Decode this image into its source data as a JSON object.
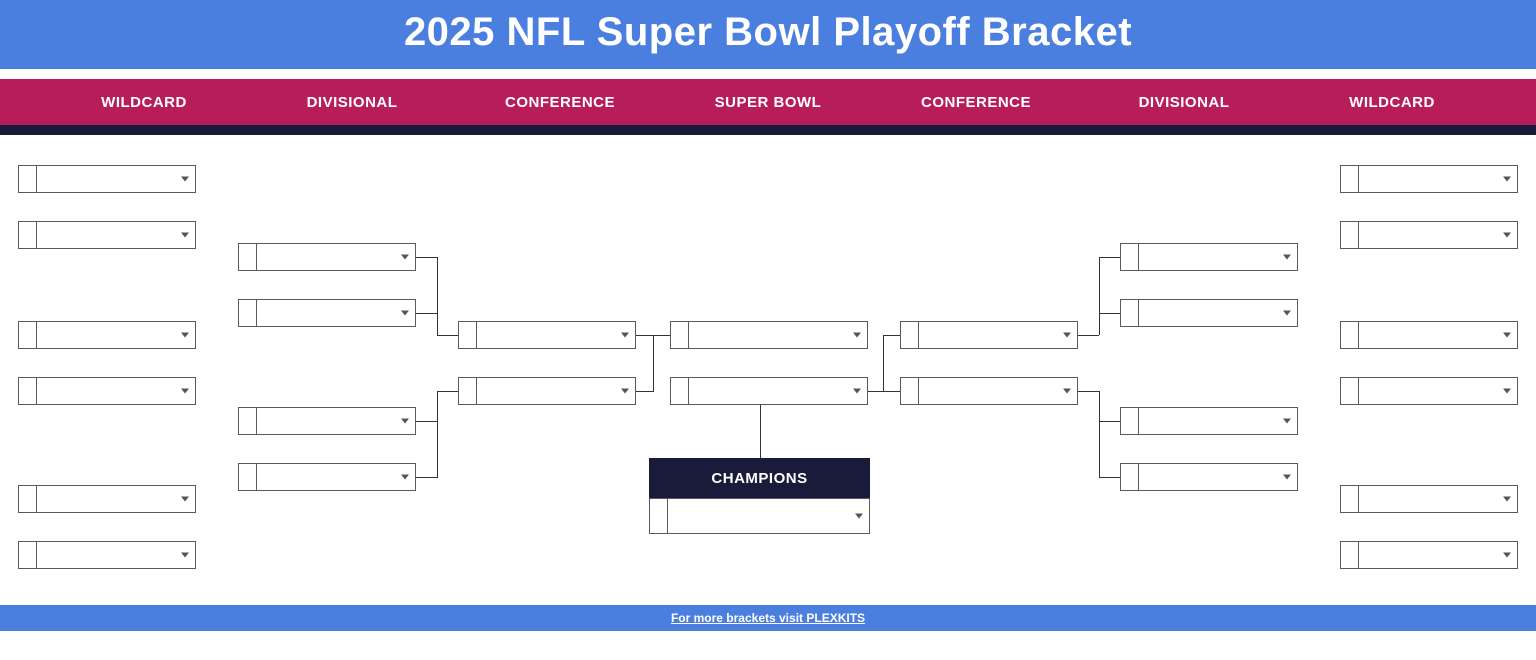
{
  "title": "2025 NFL Super Bowl Playoff Bracket",
  "rounds": [
    "WILDCARD",
    "DIVISIONAL",
    "CONFERENCE",
    "SUPER BOWL",
    "CONFERENCE",
    "DIVISIONAL",
    "WILDCARD"
  ],
  "champions_label": "CHAMPIONS",
  "footer": "For more brackets visit PLEXKITS",
  "colors": {
    "title_bg": "#4a7fe0",
    "round_bg": "#b71d5b",
    "round_border": "#1a1b3a",
    "champions_bg": "#1a1b3a"
  }
}
